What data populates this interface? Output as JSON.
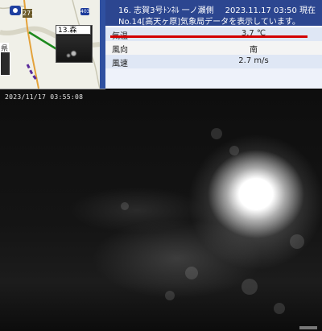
{
  "map": {
    "camera_label": "13.森",
    "left_place_label": "県",
    "route_number": "271",
    "route_shield_2": "403"
  },
  "info": {
    "title": "16. 志賀3号ﾄﾝﾈﾙ 一ノ瀬側",
    "timestamp": "2023.11.17 03:50 現在",
    "source_note": "No.14[高天ヶ原]気象局データを表示しています。",
    "rows": [
      {
        "label": "気温",
        "value": "3.7 ℃"
      },
      {
        "label": "風向",
        "value": "南"
      },
      {
        "label": "風速",
        "value": "2.7 m/s"
      }
    ]
  },
  "camera": {
    "timestamp": "2023/11/17 03:55:08"
  },
  "colors": {
    "header_bg": "#2c4690",
    "row_highlight": "#dfe7f5",
    "underline_red": "#d40000"
  }
}
